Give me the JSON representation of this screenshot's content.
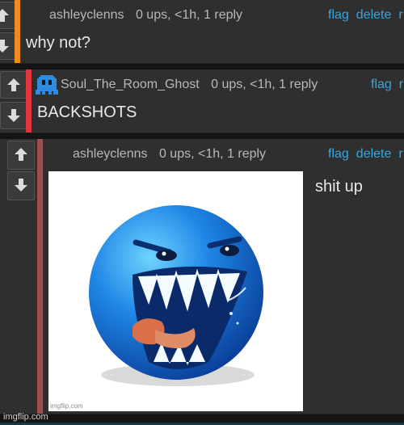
{
  "comments": [
    {
      "username": "ashleyclenns",
      "meta": "0 ups, <1h, 1 reply",
      "flag": "flag",
      "delete": "delete",
      "reply_glyph": "r",
      "text": "why not?",
      "bar_color": "#f08c1c"
    },
    {
      "username": "Soul_The_Room_Ghost",
      "meta": "0 ups, <1h, 1 reply",
      "flag": "flag",
      "reply_glyph": "r",
      "text": "BACKSHOTS",
      "bar_color": "#e2343a",
      "avatar_icon": "space-invader-ghost-icon"
    },
    {
      "username": "ashleyclenns",
      "meta": "0 ups, <1h, 1 reply",
      "flag": "flag",
      "delete": "delete",
      "reply_glyph": "r",
      "text": "shit up",
      "bar_color": "#9b5050",
      "image_watermark": "imgflip.com"
    }
  ],
  "footer_watermark": "imgflip.com",
  "colors": {
    "link": "#39a6dd",
    "panel": "#2f2f2f",
    "background": "#141414"
  }
}
